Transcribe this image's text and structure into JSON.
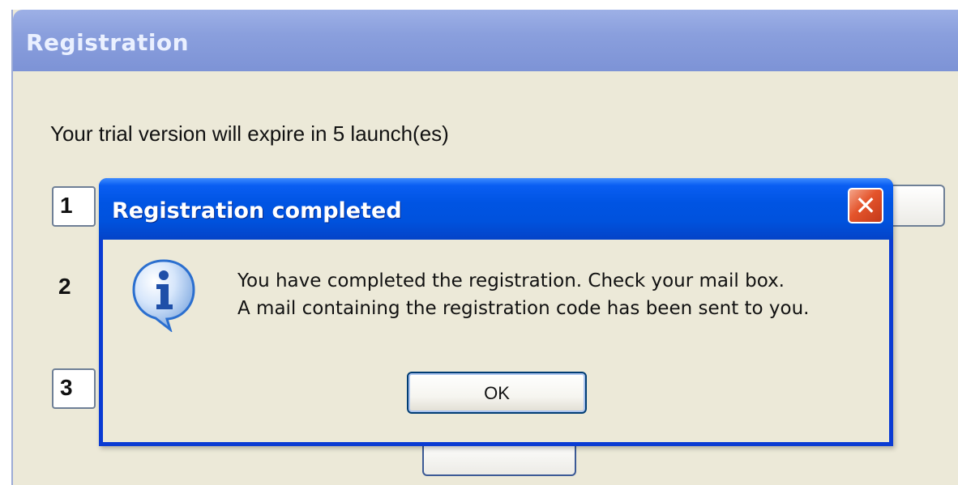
{
  "background_window": {
    "title": "Registration",
    "trial_text": "Your trial version will expire in 5 launch(es)",
    "steps": [
      "1",
      "2",
      "3"
    ]
  },
  "dialog": {
    "title": "Registration completed",
    "close_label": "✕",
    "icon": "info-icon",
    "message_lines": [
      "You have completed the registration. Check your mail box.",
      "A mail containing the registration code has been sent to you."
    ],
    "ok_label": "OK"
  },
  "colors": {
    "dialog_titlebar": "#0054e3",
    "close_button": "#e4542b",
    "window_face": "#ece9d8",
    "info_icon": "#2b6fcf"
  }
}
